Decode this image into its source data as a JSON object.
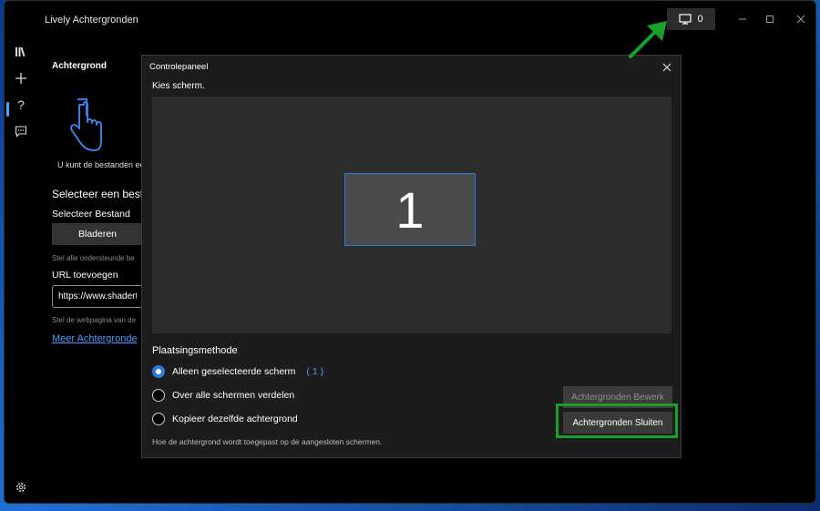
{
  "window": {
    "title": "Lively Achtergronden",
    "monitor_count": "0"
  },
  "sidebar": {
    "items": [
      "library-icon",
      "add-icon",
      "help-icon",
      "feedback-icon"
    ],
    "settings": "settings-icon"
  },
  "background_panel": {
    "heading": "Achtergrond",
    "description": "U kunt de bestanden ee",
    "section_title": "Selecteer een best",
    "file_label": "Selecteer Bestand",
    "browse_button": "Bladeren",
    "hint_file": "Stel alle ondersteunde be",
    "url_label": "URL toevoegen",
    "url_value": "https://www.shadert",
    "hint_url": "Stel de webpagina van de",
    "more_link": "Meer Achtergronde"
  },
  "dialog": {
    "title": "Controlepaneel",
    "choose_screen": "Kies scherm.",
    "screen_number": "1",
    "placement_label": "Plaatsingsmethode",
    "options": [
      {
        "label": "Alleen geselecteerde scherm",
        "count": "( 1 )",
        "checked": true
      },
      {
        "label": "Over alle schermen verdelen",
        "count": "",
        "checked": false
      },
      {
        "label": "Kopieer dezelfde achtergrond",
        "count": "",
        "checked": false
      }
    ],
    "hint": "Hoe de achtergrond wordt toegepast op de aangesloten schermen.",
    "edit_button": "Achtergronden Bewerk",
    "close_button": "Achtergronden Sluiten"
  },
  "colors": {
    "accent": "#2f7ad9",
    "link": "#4c9bff",
    "highlight": "#17a02b"
  }
}
